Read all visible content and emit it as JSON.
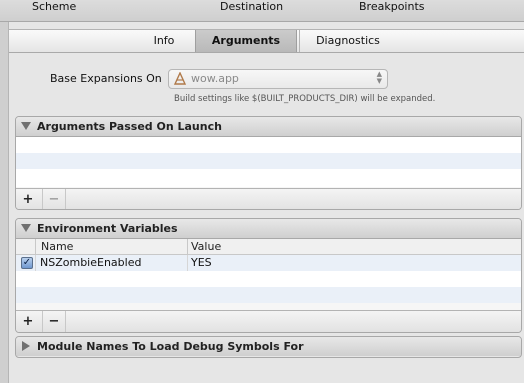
{
  "toolbar": {
    "scheme": "Scheme",
    "destination": "Destination",
    "breakpoints": "Breakpoints"
  },
  "tabs": [
    {
      "label": "Info",
      "active": false
    },
    {
      "label": "Arguments",
      "active": true
    },
    {
      "label": "Diagnostics",
      "active": false
    }
  ],
  "base_expansion": {
    "label": "Base Expansions On",
    "selected": "wow.app",
    "hint": "Build settings like $(BUILT_PRODUCTS_DIR) will be expanded."
  },
  "arguments_section": {
    "title": "Arguments Passed On Launch",
    "add_label": "+",
    "remove_label": "−"
  },
  "env_section": {
    "title": "Environment Variables",
    "columns": {
      "name": "Name",
      "value": "Value"
    },
    "rows": [
      {
        "enabled": true,
        "name": "NSZombieEnabled",
        "value": "YES"
      }
    ],
    "add_label": "+",
    "remove_label": "−"
  },
  "module_section": {
    "title": "Module Names To Load Debug Symbols For"
  },
  "icons": {
    "app": "app-icon",
    "stepper": "popup-stepper-icon",
    "disclosure_open": "disclosure-open-icon",
    "disclosure_closed": "disclosure-closed-icon",
    "checkbox": "checkbox-icon"
  },
  "colors": {
    "active_tab": "#c2c2c2",
    "alternate_row": "#eaf0f8",
    "checkbox": "#6f97cf"
  }
}
